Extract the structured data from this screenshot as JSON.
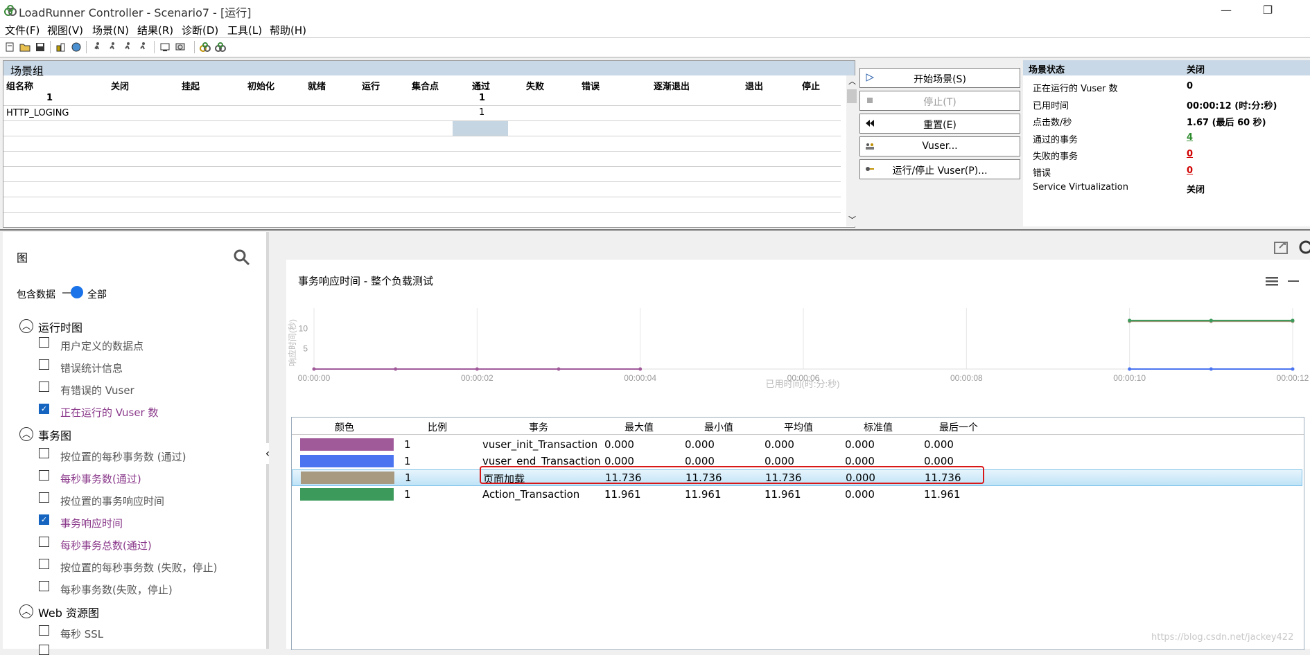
{
  "window": {
    "title": "LoadRunner Controller - Scenario7 - [运行]",
    "min_icon": "minimize-icon",
    "max_icon": "maximize-icon"
  },
  "menu": [
    "文件(F)",
    "视图(V)",
    "场景(N)",
    "结果(R)",
    "诊断(D)",
    "工具(L)",
    "帮助(H)"
  ],
  "group": {
    "header": "场景组",
    "columns": [
      "组名称",
      "关闭",
      "挂起",
      "初始化",
      "就绪",
      "运行",
      "集合点",
      "通过",
      "失败",
      "错误",
      "逐渐退出",
      "退出",
      "停止"
    ],
    "totals": {
      "name": "1",
      "passed": "1"
    },
    "rows": [
      {
        "name": "HTTP_LOGING",
        "passed": "1"
      }
    ]
  },
  "controls": {
    "start": "开始场景(S)",
    "stop": "停止(T)",
    "reset": "重置(E)",
    "vusers": "Vuser...",
    "run_stop": "运行/停止 Vuser(P)..."
  },
  "status": {
    "header_label": "场景状态",
    "header_value": "关闭",
    "rows": [
      {
        "label": "正在运行的 Vuser 数",
        "value": "0"
      },
      {
        "label": "已用时间",
        "value": "00:00:12 (时:分:秒)"
      },
      {
        "label": "点击数/秒",
        "value": "1.67 (最后 60 秒)"
      },
      {
        "label": "通过的事务",
        "value": "4",
        "color": "#2e8b2e"
      },
      {
        "label": "失败的事务",
        "value": "0",
        "color": "#d00000"
      },
      {
        "label": "错误",
        "value": "0",
        "color": "#d00000"
      },
      {
        "label": "Service Virtualization",
        "value": "关闭"
      }
    ]
  },
  "graphs": {
    "title": "图",
    "include_data_label": "包含数据",
    "include_data_value": "全部",
    "sections": [
      {
        "title": "运行时图",
        "items": [
          {
            "label": "用户定义的数据点",
            "checked": false,
            "purple": false
          },
          {
            "label": "错误统计信息",
            "checked": false,
            "purple": false
          },
          {
            "label": "有错误的 Vuser",
            "checked": false,
            "purple": false
          },
          {
            "label": "正在运行的 Vuser 数",
            "checked": true,
            "purple": true
          }
        ]
      },
      {
        "title": "事务图",
        "items": [
          {
            "label": "按位置的每秒事务数 (通过)",
            "checked": false,
            "purple": false
          },
          {
            "label": "每秒事务数(通过)",
            "checked": false,
            "purple": true
          },
          {
            "label": "按位置的事务响应时间",
            "checked": false,
            "purple": false
          },
          {
            "label": "事务响应时间",
            "checked": true,
            "purple": true
          },
          {
            "label": "每秒事务总数(通过)",
            "checked": false,
            "purple": true
          },
          {
            "label": "按位置的每秒事务数 (失败，停止)",
            "checked": false,
            "purple": false
          },
          {
            "label": "每秒事务数(失败，停止)",
            "checked": false,
            "purple": false
          }
        ]
      },
      {
        "title": "Web 资源图",
        "items": [
          {
            "label": "每秒 SSL",
            "checked": false,
            "purple": false
          }
        ]
      }
    ]
  },
  "chart_data": {
    "type": "line",
    "title": "事务响应时间 - 整个负载测试",
    "xlabel": "已用时间(时:分:秒)",
    "ylabel": "响应时间(秒)",
    "x_ticks": [
      "00:00:00",
      "00:00:02",
      "00:00:04",
      "00:00:06",
      "00:00:08",
      "00:00:10",
      "00:00:12"
    ],
    "y_ticks": [
      5,
      10
    ],
    "xlim": [
      0,
      12
    ],
    "ylim": [
      0,
      15
    ],
    "grid": true,
    "series": [
      {
        "name": "vuser_init_Transaction",
        "color": "#a05a9a",
        "x": [
          0,
          1,
          2,
          3,
          4
        ],
        "y": [
          0,
          0,
          0,
          0,
          0
        ]
      },
      {
        "name": "vuser_end_Transaction",
        "color": "#4a74f0",
        "x": [
          10,
          11,
          12
        ],
        "y": [
          0,
          0,
          0
        ]
      },
      {
        "name": "页面加载",
        "color": "#a89a80",
        "x": [
          10,
          11,
          12
        ],
        "y": [
          11.736,
          11.736,
          11.736
        ]
      },
      {
        "name": "Action_Transaction",
        "color": "#3c9a5a",
        "x": [
          10,
          11,
          12
        ],
        "y": [
          11.961,
          11.961,
          11.961
        ]
      }
    ]
  },
  "legend": {
    "columns": [
      "颜色",
      "比例",
      "事务",
      "最大值",
      "最小值",
      "平均值",
      "标准值",
      "最后一个"
    ],
    "rows": [
      {
        "color": "#a05a9a",
        "scale": "1",
        "name": "vuser_init_Transaction",
        "max": "0.000",
        "min": "0.000",
        "avg": "0.000",
        "std": "0.000",
        "last": "0.000"
      },
      {
        "color": "#4a74f0",
        "scale": "1",
        "name": "vuser_end_Transaction",
        "max": "0.000",
        "min": "0.000",
        "avg": "0.000",
        "std": "0.000",
        "last": "0.000"
      },
      {
        "color": "#a89a80",
        "scale": "1",
        "name": "页面加载",
        "max": "11.736",
        "min": "11.736",
        "avg": "11.736",
        "std": "0.000",
        "last": "11.736"
      },
      {
        "color": "#3c9a5a",
        "scale": "1",
        "name": "Action_Transaction",
        "max": "11.961",
        "min": "11.961",
        "avg": "11.961",
        "std": "0.000",
        "last": "11.961"
      }
    ]
  },
  "watermark": "https://blog.csdn.net/jackey422"
}
